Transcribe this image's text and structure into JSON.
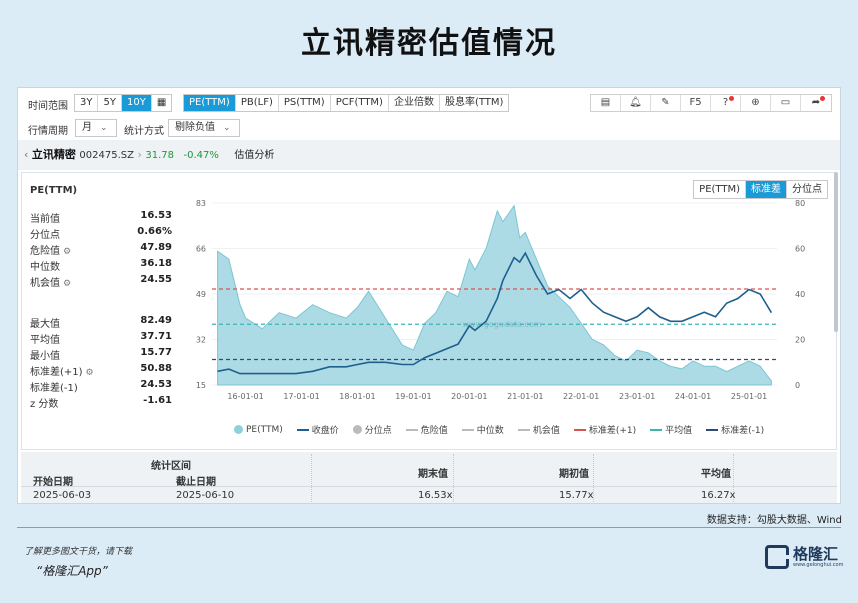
{
  "title": "立讯精密估值情况",
  "toolbar": {
    "time_range_label": "时间范围",
    "ranges": [
      "3Y",
      "5Y",
      "10Y",
      "▦"
    ],
    "active_range": "10Y",
    "metrics": [
      "PE(TTM)",
      "PB(LF)",
      "PS(TTM)",
      "PCF(TTM)",
      "企业倍数",
      "股息率(TTM)"
    ],
    "active_metric": "PE(TTM)",
    "period_label": "行情周期",
    "period_value": "月",
    "method_label": "统计方式",
    "method_value": "剔除负值",
    "icons": [
      "report-icon",
      "bell-icon",
      "edit-icon",
      "F5",
      "help-icon",
      "plus-icon",
      "screen-icon",
      "share-icon"
    ],
    "f5_label": "F5"
  },
  "breadcrumb": {
    "name": "立讯精密",
    "code": "002475.SZ",
    "price": "31.78",
    "change": "-0.47%",
    "section": "估值分析"
  },
  "stats": {
    "heading": "PE(TTM)",
    "current_label": "当前值",
    "current": "16.53",
    "pct_label": "分位点",
    "pct": "0.66%",
    "danger_label": "危险值",
    "danger": "47.89",
    "median_label": "中位数",
    "median": "36.18",
    "chance_label": "机会值",
    "chance": "24.55",
    "max_label": "最大值",
    "max": "82.49",
    "avg_label": "平均值",
    "avg": "37.71",
    "min_label": "最小值",
    "min": "15.77",
    "sd_plus_label": "标准差(+1)",
    "sd_plus": "50.88",
    "sd_minus_label": "标准差(-1)",
    "sd_minus": "24.53",
    "z_label": "z 分数",
    "z": "-1.61"
  },
  "modes": [
    "PE(TTM)",
    "标准差",
    "分位点"
  ],
  "active_mode": "标准差",
  "watermark": "www.gogudata.com",
  "legend": [
    {
      "label": "PE(TTM)",
      "color": "#8fd0dd",
      "kind": "dot"
    },
    {
      "label": "收盘价",
      "color": "#1f5f8f",
      "kind": "line"
    },
    {
      "label": "分位点",
      "color": "#bbbbbb",
      "kind": "dot"
    },
    {
      "label": "危险值",
      "color": "#bbbbbb",
      "kind": "line"
    },
    {
      "label": "中位数",
      "color": "#bbbbbb",
      "kind": "line"
    },
    {
      "label": "机会值",
      "color": "#bbbbbb",
      "kind": "line"
    },
    {
      "label": "标准差(+1)",
      "color": "#d9534f",
      "kind": "dash"
    },
    {
      "label": "平均值",
      "color": "#3fb3b3",
      "kind": "dash"
    },
    {
      "label": "标准差(-1)",
      "color": "#2c4a7a",
      "kind": "dash"
    }
  ],
  "chart_data": {
    "type": "area",
    "title": "",
    "x_ticks": [
      "16-01-01",
      "17-01-01",
      "18-01-01",
      "19-01-01",
      "20-01-01",
      "21-01-01",
      "22-01-01",
      "23-01-01",
      "24-01-01",
      "25-01-01"
    ],
    "y_left_ticks": [
      15,
      32,
      49,
      66,
      83
    ],
    "y_right_ticks": [
      0,
      20,
      40,
      60,
      80
    ],
    "ylim_left": [
      15,
      83
    ],
    "ylim_right": [
      0,
      80
    ],
    "x": [
      2015.5,
      2015.7,
      2015.9,
      2016.0,
      2016.3,
      2016.6,
      2016.9,
      2017.2,
      2017.5,
      2017.8,
      2018.0,
      2018.2,
      2018.5,
      2018.8,
      2019.0,
      2019.2,
      2019.4,
      2019.6,
      2019.8,
      2020.0,
      2020.1,
      2020.3,
      2020.5,
      2020.6,
      2020.8,
      2020.9,
      2021.0,
      2021.2,
      2021.4,
      2021.6,
      2021.8,
      2022.0,
      2022.2,
      2022.4,
      2022.6,
      2022.8,
      2023.0,
      2023.2,
      2023.4,
      2023.6,
      2023.8,
      2024.0,
      2024.2,
      2024.4,
      2024.6,
      2024.8,
      2025.0,
      2025.2,
      2025.4
    ],
    "series": [
      {
        "name": "PE(TTM)",
        "axis": "left",
        "values": [
          65,
          62,
          45,
          40,
          36,
          42,
          40,
          45,
          42,
          40,
          44,
          50,
          40,
          30,
          28,
          38,
          42,
          50,
          48,
          62,
          58,
          66,
          80,
          76,
          82,
          70,
          72,
          62,
          52,
          48,
          44,
          38,
          32,
          30,
          26,
          24,
          28,
          27,
          24,
          22,
          21,
          24,
          22,
          22,
          20,
          22,
          24,
          22,
          16.5
        ]
      },
      {
        "name": "收盘价",
        "axis": "right",
        "values": [
          6,
          7,
          5,
          5,
          5,
          5,
          5,
          6,
          8,
          8,
          9,
          10,
          10,
          9,
          9,
          12,
          14,
          16,
          18,
          26,
          24,
          28,
          38,
          46,
          56,
          54,
          58,
          48,
          40,
          42,
          38,
          42,
          36,
          32,
          30,
          28,
          30,
          34,
          30,
          28,
          28,
          30,
          32,
          30,
          36,
          38,
          42,
          40,
          31.78
        ]
      }
    ],
    "reference_lines": [
      {
        "name": "标准差(+1)",
        "value": 50.88,
        "color": "#d9534f"
      },
      {
        "name": "平均值",
        "value": 37.71,
        "color": "#3fb3b3"
      },
      {
        "name": "标准差(-1)",
        "value": 24.53,
        "color": "#2c4a7a"
      }
    ]
  },
  "table": {
    "section_label": "统计区间",
    "col_start": "开始日期",
    "col_end": "截止日期",
    "col_end_value": "期末值",
    "col_start_value": "期初值",
    "col_avg": "平均值",
    "row": {
      "start": "2025-06-03",
      "end": "2025-06-10",
      "end_value": "16.53x",
      "start_value": "15.77x",
      "avg": "16.27x"
    }
  },
  "source": "数据支持：勾股大数据、Wind",
  "footer": {
    "line1": "了解更多图文干货，请下载",
    "line2": "“格隆汇App”",
    "logo_text": "格隆汇",
    "logo_sub": "www.gelonghui.com"
  }
}
